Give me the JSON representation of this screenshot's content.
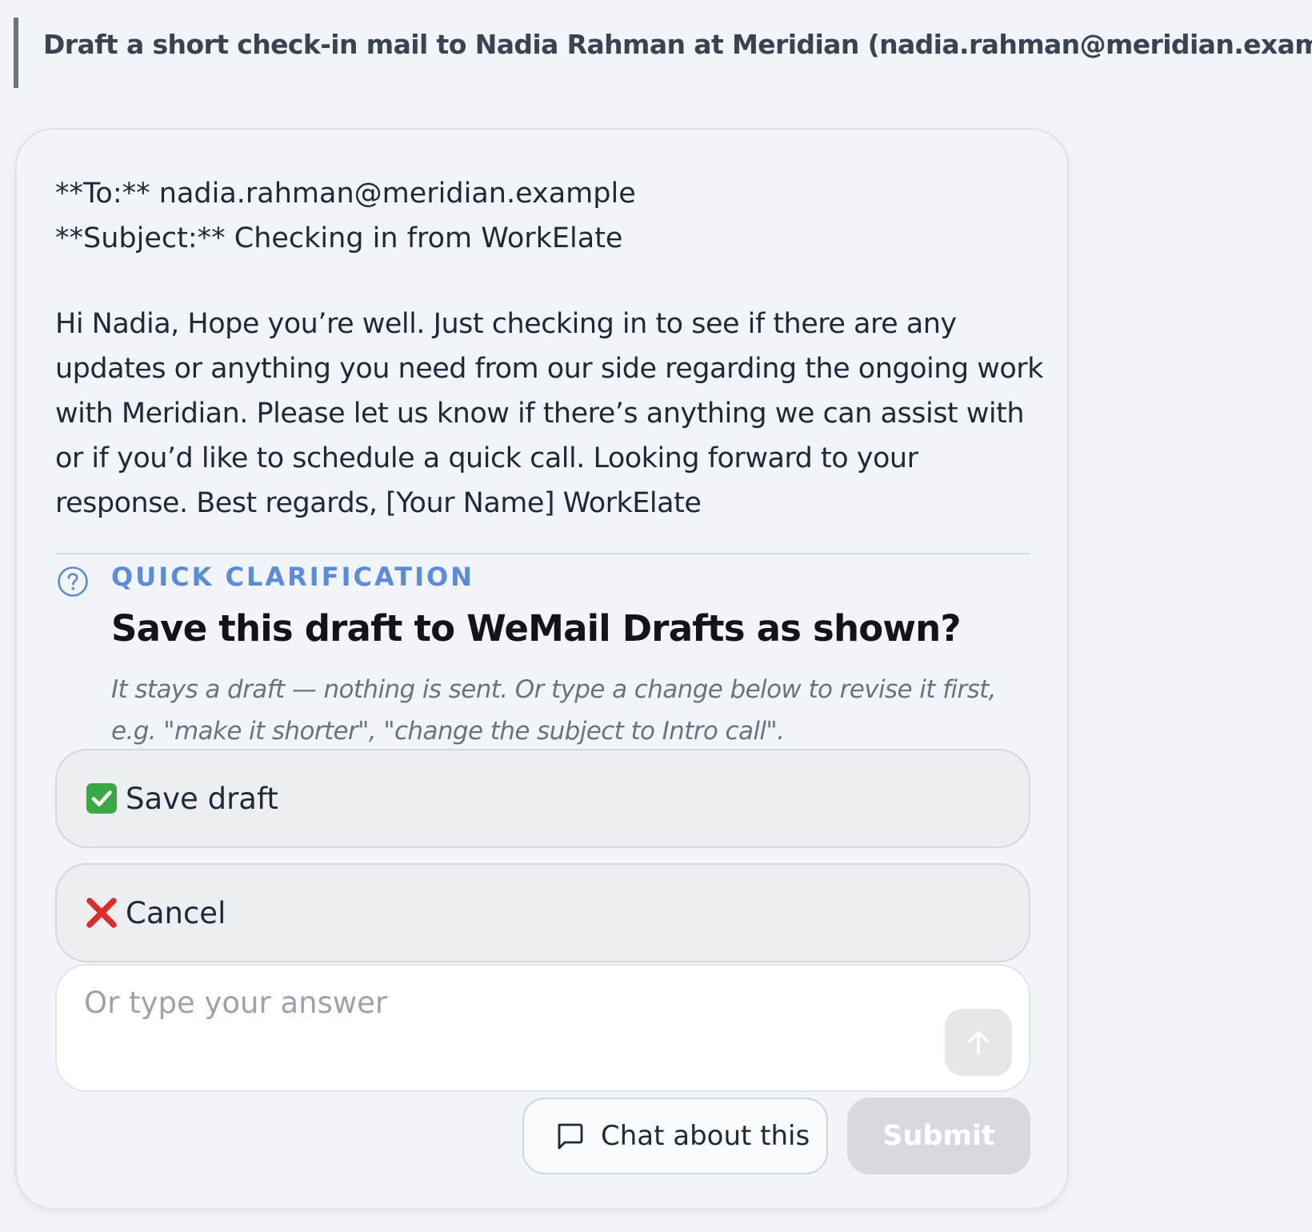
{
  "prompt": {
    "text": "Draft a short check-in mail to Nadia Rahman at Meridian (nadia.rahman@meridian.example)"
  },
  "email": {
    "to_line": "**To:** nadia.rahman@meridian.example",
    "subject_line": "**Subject:** Checking in from WorkElate",
    "body": "Hi Nadia, Hope you’re well. Just checking in to see if there are any updates or anything you need from our side regarding the ongoing work with Meridian. Please let us know if there’s anything we can assist with or if you’d like to schedule a quick call. Looking forward to your response. Best regards, [Your Name] WorkElate"
  },
  "clarification": {
    "label": "QUICK CLARIFICATION",
    "icon": "question-circle-icon",
    "question": "Save this draft to WeMail Drafts as shown?",
    "hint": "It stays a draft — nothing is sent. Or type a change below to revise it first, e.g. \"make it shorter\", \"change the subject to Intro call\".",
    "options": [
      {
        "label": "Save draft",
        "icon": "check-mark-button-icon"
      },
      {
        "label": "Cancel",
        "icon": "cross-mark-icon"
      }
    ],
    "answer_input": {
      "value": "",
      "placeholder": "Or type your answer"
    },
    "send_icon": "arrow-up-icon",
    "chat_button": {
      "label": "Chat about this",
      "icon": "chat-bubble-icon"
    },
    "submit_button": {
      "label": "Submit",
      "disabled": true
    }
  },
  "colors": {
    "accent": "#5b8bdb",
    "page_background": "#f1f4f8",
    "option_background": "#eceef2",
    "submit_disabled": "#d6dade",
    "check_green": "#3aa845",
    "cross_red": "#dc2b2b"
  }
}
